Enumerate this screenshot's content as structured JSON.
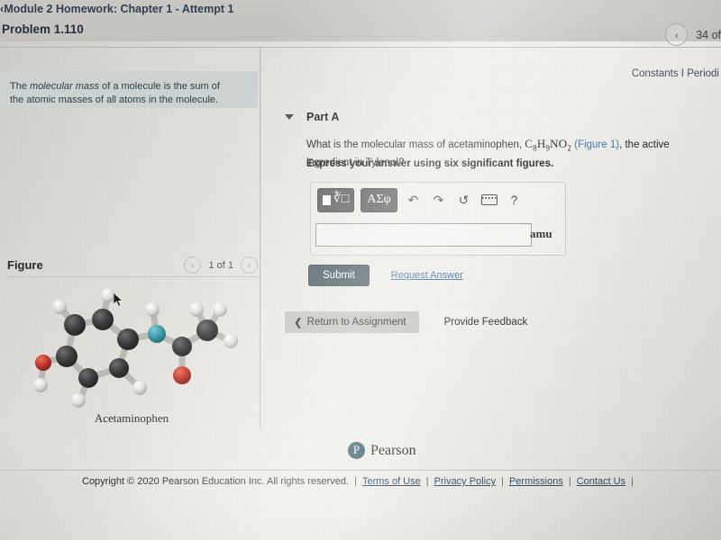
{
  "header": {
    "back_icon": "chevron-left-icon",
    "breadcrumb": "Module 2 Homework: Chapter 1 - Attempt 1",
    "problem_title": "Problem 1.110",
    "prev_icon": "chevron-left-circle-icon",
    "item_counter": "34 of"
  },
  "constants_bar": {
    "text": "Constants I Periodi"
  },
  "hint": {
    "text_before": "The ",
    "emphasis": "molecular mass",
    "text_after": " of a molecule is the sum of the atomic masses of all atoms in the molecule."
  },
  "figure_panel": {
    "label": "Figure",
    "prev_icon": "chevron-left-icon",
    "pager": "1 of 1",
    "next_icon": "chevron-right-icon",
    "caption": "Acetaminophen",
    "molecule_name": "acetaminophen-ball-and-stick-model",
    "atom_colors": {
      "carbon": "#3b3b3d",
      "hydrogen": "#e4e4e2",
      "oxygen": "#c0392b",
      "nitrogen": "#3d9aa8",
      "bond": "#b9b7b2"
    }
  },
  "part_a": {
    "collapse_icon": "triangle-down-icon",
    "title": "Part A",
    "question_prefix": "What is the molecular mass of acetaminophen, ",
    "formula": {
      "c": "C",
      "c_sub": "8",
      "h": "H",
      "h_sub": "9",
      "n": "N",
      "o": "O",
      "o_sub": "2"
    },
    "figure_link": "(Figure 1)",
    "question_suffix": ", the active ingredient in Tylenol?",
    "instruction": "Express your answer using six significant figures."
  },
  "answer_widget": {
    "toolbar": [
      {
        "name": "math-template-button",
        "label": "□ⁿ√□",
        "icon": "nth-root-icon",
        "style": "dark"
      },
      {
        "name": "greek-symbols-button",
        "label": "ΑΣφ",
        "icon": "greek-letters-icon",
        "style": "dark"
      },
      {
        "name": "undo-button",
        "label": "↶",
        "icon": "undo-arrow-icon",
        "style": "plain"
      },
      {
        "name": "redo-button",
        "label": "↷",
        "icon": "redo-arrow-icon",
        "style": "plain"
      },
      {
        "name": "reset-button",
        "label": "↺",
        "icon": "reset-circle-icon",
        "style": "plain"
      },
      {
        "name": "keyboard-button",
        "label": "",
        "icon": "keyboard-icon",
        "style": "plain"
      },
      {
        "name": "help-button",
        "label": "?",
        "icon": "question-mark-icon",
        "style": "plain"
      }
    ],
    "input_value": "",
    "input_placeholder": "",
    "unit": "amu"
  },
  "actions": {
    "submit_label": "Submit",
    "request_answer_label": "Request Answer",
    "return_icon": "chevron-left-icon",
    "return_label": "Return to Assignment",
    "feedback_label": "Provide Feedback"
  },
  "branding": {
    "mark": "P",
    "wordmark": "Pearson"
  },
  "footer": {
    "copyright": "Copyright © 2020 Pearson Education Inc. All rights reserved.",
    "links": [
      "Terms of Use",
      "Privacy Policy",
      "Permissions",
      "Contact Us"
    ]
  },
  "colors": {
    "accent_link": "#2f6fa8",
    "submit_bg": "#44565e",
    "hint_bg": "#ccd2d2",
    "brand_teal": "#3e6370"
  }
}
